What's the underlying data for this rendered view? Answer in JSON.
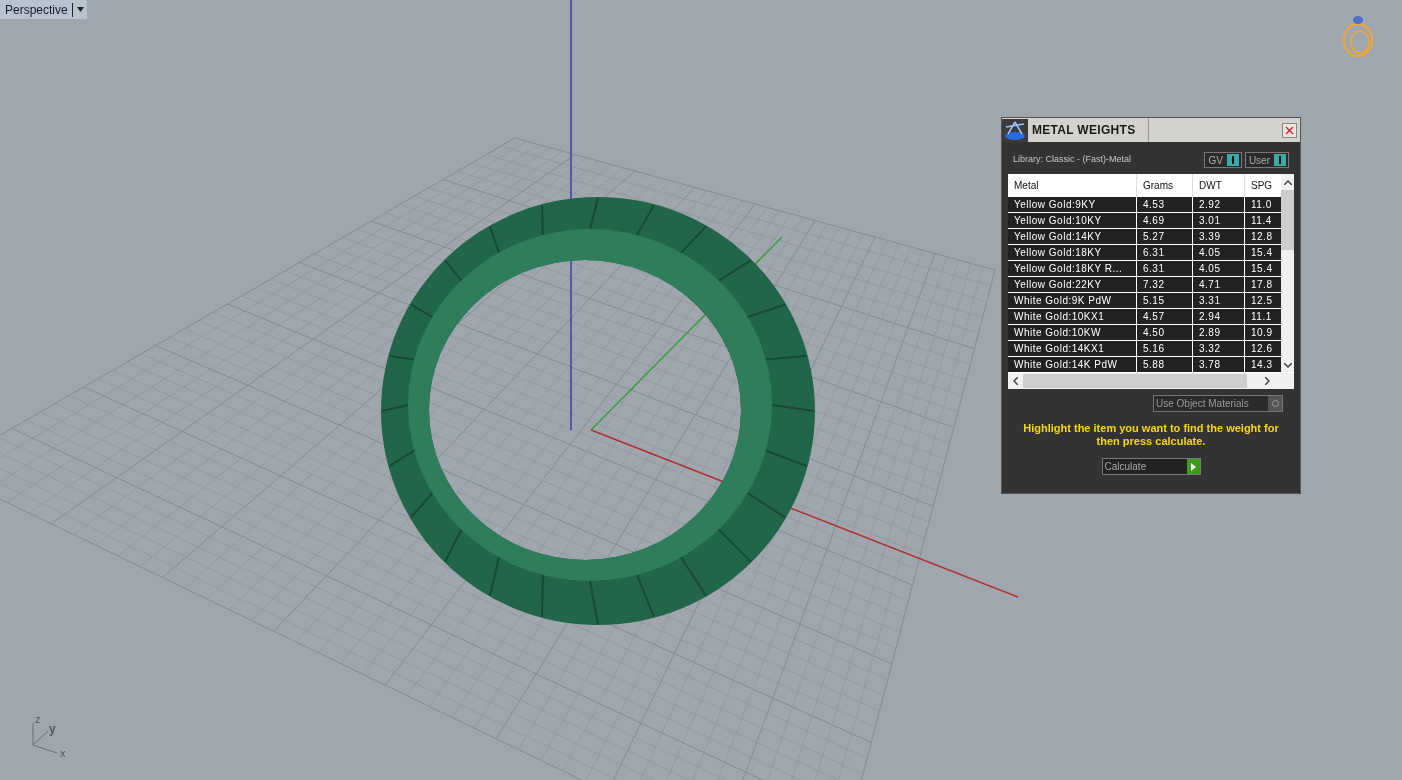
{
  "viewport": {
    "label": "Perspective",
    "axes": [
      "z",
      "y",
      "x"
    ]
  },
  "dialog": {
    "title": "METAL WEIGHTS",
    "library": "Library: Classic - (Fast)-Metal",
    "toggles": [
      {
        "label": "GV",
        "on": true
      },
      {
        "label": "User",
        "on": true
      }
    ],
    "table": {
      "columns": [
        "Metal",
        "Grams",
        "DWT",
        "SPG"
      ],
      "rows": [
        [
          "Yellow Gold:9KY",
          "4.53",
          "2.92",
          "11.0"
        ],
        [
          "Yellow Gold:10KY",
          "4.69",
          "3.01",
          "11.4"
        ],
        [
          "Yellow Gold:14KY",
          "5.27",
          "3.39",
          "12.8"
        ],
        [
          "Yellow Gold:18KY",
          "6.31",
          "4.05",
          "15.4"
        ],
        [
          "Yellow Gold:18KY R...",
          "6.31",
          "4.05",
          "15.4"
        ],
        [
          "Yellow Gold:22KY",
          "7.32",
          "4.71",
          "17.8"
        ],
        [
          "White Gold:9K PdW",
          "5.15",
          "3.31",
          "12.5"
        ],
        [
          "White Gold:10KX1",
          "4.57",
          "2.94",
          "11.1"
        ],
        [
          "White Gold:10KW",
          "4.50",
          "2.89",
          "10.9"
        ],
        [
          "White Gold:14KX1",
          "5.16",
          "3.32",
          "12.6"
        ],
        [
          "White Gold:14K PdW",
          "5.88",
          "3.78",
          "14.3"
        ]
      ]
    },
    "option": {
      "label": "Use Object Materials",
      "checked": false
    },
    "hint": "Highlight the item you want to find the weight for then press calculate.",
    "button": "Calculate"
  }
}
